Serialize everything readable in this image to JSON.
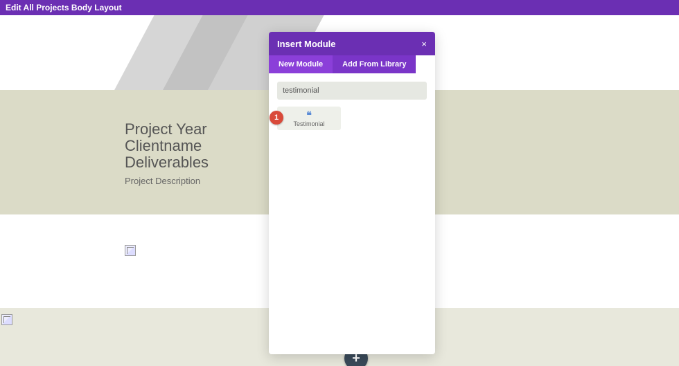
{
  "topbar": {
    "title": "Edit All Projects Body Layout"
  },
  "project": {
    "line1": "Project Year",
    "line2": "Clientname",
    "line3": "Deliverables",
    "desc": "Project Description"
  },
  "modal": {
    "title": "Insert Module",
    "close_glyph": "×",
    "tabs": {
      "new": "New Module",
      "library": "Add From Library"
    },
    "search_value": "testimonial",
    "module": {
      "icon_glyph": "❝",
      "label": "Testimonial"
    },
    "step_badge": "1"
  },
  "add_button": {
    "glyph": "+"
  }
}
